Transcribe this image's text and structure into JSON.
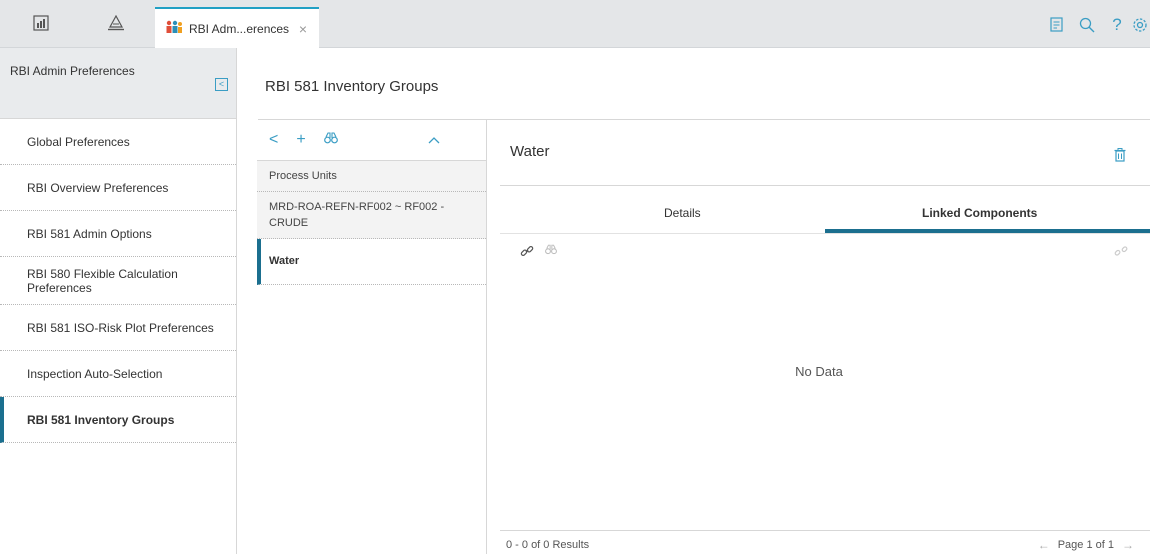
{
  "topbar": {
    "home_icon": "dashboard-icon",
    "tree_icon": "hierarchy-icon",
    "tab_label": "RBI Adm...erences",
    "tab_close": "×",
    "right_icons": [
      "notes-icon",
      "search-icon",
      "help-icon",
      "settings-icon"
    ],
    "help_glyph": "?"
  },
  "sidebar": {
    "title": "RBI Admin Preferences",
    "collapse_glyph": "<",
    "items": [
      {
        "label": "Global Preferences"
      },
      {
        "label": "RBI Overview Preferences"
      },
      {
        "label": "RBI 581 Admin Options"
      },
      {
        "label": "RBI 580 Flexible Calculation Preferences"
      },
      {
        "label": "RBI 581 ISO-Risk Plot Preferences"
      },
      {
        "label": "Inspection Auto-Selection"
      },
      {
        "label": "RBI 581 Inventory Groups"
      }
    ]
  },
  "page": {
    "title": "RBI 581 Inventory Groups"
  },
  "list_panel": {
    "back_glyph": "<",
    "add_glyph": "+",
    "group_header": "Process Units",
    "items": [
      {
        "label": "MRD-ROA-REFN-RF002 ~ RF002 - CRUDE"
      },
      {
        "label": "Water"
      }
    ]
  },
  "detail": {
    "title": "Water",
    "tabs": [
      {
        "label": "Details"
      },
      {
        "label": "Linked Components"
      }
    ],
    "empty_message": "No Data",
    "results": "0 - 0 of 0 Results",
    "page_label": "Page 1 of 1",
    "prev_glyph": "←",
    "next_glyph": "→"
  },
  "colors": {
    "accent": "#3a9dc4",
    "active_border": "#1b6f8f"
  }
}
